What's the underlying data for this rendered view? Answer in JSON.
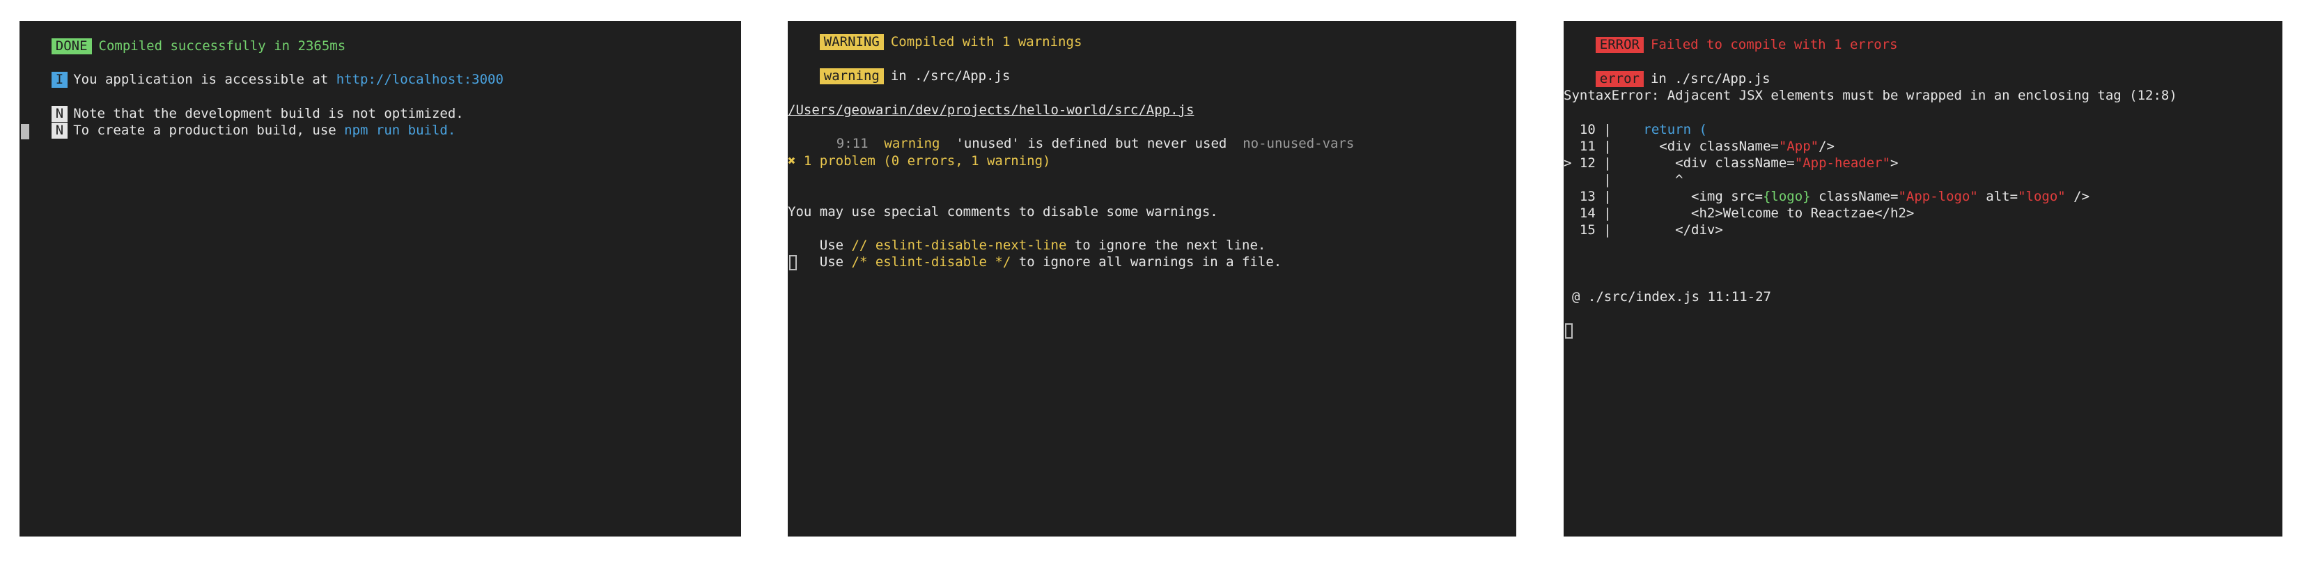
{
  "colors": {
    "terminal_bg": "#1f1f1f",
    "text": "#e6e6e6",
    "success": "#74d26e",
    "info": "#4aa3e0",
    "warning": "#e8c64d",
    "error": "#e23d3d",
    "muted": "#9c9c9c"
  },
  "panel_success": {
    "badge": "DONE",
    "message": "Compiled successfully in 2365ms",
    "info_badge": "I",
    "info_text": "You application is accessible at ",
    "url": "http://localhost:3000",
    "note_badge": "N",
    "note_line1": "Note that the development build is not optimized.",
    "note_line2_prefix": "To create a production build, use ",
    "note_cmd": "npm run build",
    "note_line2_suffix": "."
  },
  "panel_warning": {
    "badge": "WARNING",
    "message": "Compiled with 1 warnings",
    "file_badge": "warning",
    "file_text": "in ./src/App.js",
    "path": "/Users/geowarin/dev/projects/hello-world/src/App.js",
    "pos": "9:11",
    "level": "warning",
    "detail": "'unused' is defined but never used",
    "rule": "no-unused-vars",
    "summary": "✖ 1 problem (0 errors, 1 warning)",
    "hint1": "You may use special comments to disable some warnings.",
    "hint2_prefix": "Use ",
    "hint2_code": "// eslint-disable-next-line",
    "hint2_suffix": " to ignore the next line.",
    "hint3_prefix": "Use ",
    "hint3_code": "/* eslint-disable */",
    "hint3_suffix": " to ignore all warnings in a file."
  },
  "panel_error": {
    "badge": "ERROR",
    "message": "Failed to compile with 1 errors",
    "file_badge": "error",
    "file_text": "in ./src/App.js",
    "syntax": "SyntaxError: Adjacent JSX elements must be wrapped in an enclosing tag (12:8)",
    "code": {
      "l10_no": "  10 |",
      "l10_kw": "return (",
      "l11_no": "  11 |",
      "l11_a": "<div className=",
      "l11_s": "\"App\"",
      "l11_b": "/>",
      "l12_no": "> 12 |",
      "l12_a": "<div className=",
      "l12_s": "\"App-header\"",
      "l12_b": ">",
      "caret_no": "     |",
      "caret": "^",
      "l13_no": "  13 |",
      "l13_a": "<img src=",
      "l13_logo": "{logo}",
      "l13_b": " className=",
      "l13_s1": "\"App-logo\"",
      "l13_c": " alt=",
      "l13_s2": "\"logo\"",
      "l13_d": " />",
      "l14_no": "  14 |",
      "l14": "<h2>Welcome to Reactzae</h2>",
      "l15_no": "  15 |",
      "l15": "</div>"
    },
    "location": "@ ./src/index.js 11:11-27"
  }
}
